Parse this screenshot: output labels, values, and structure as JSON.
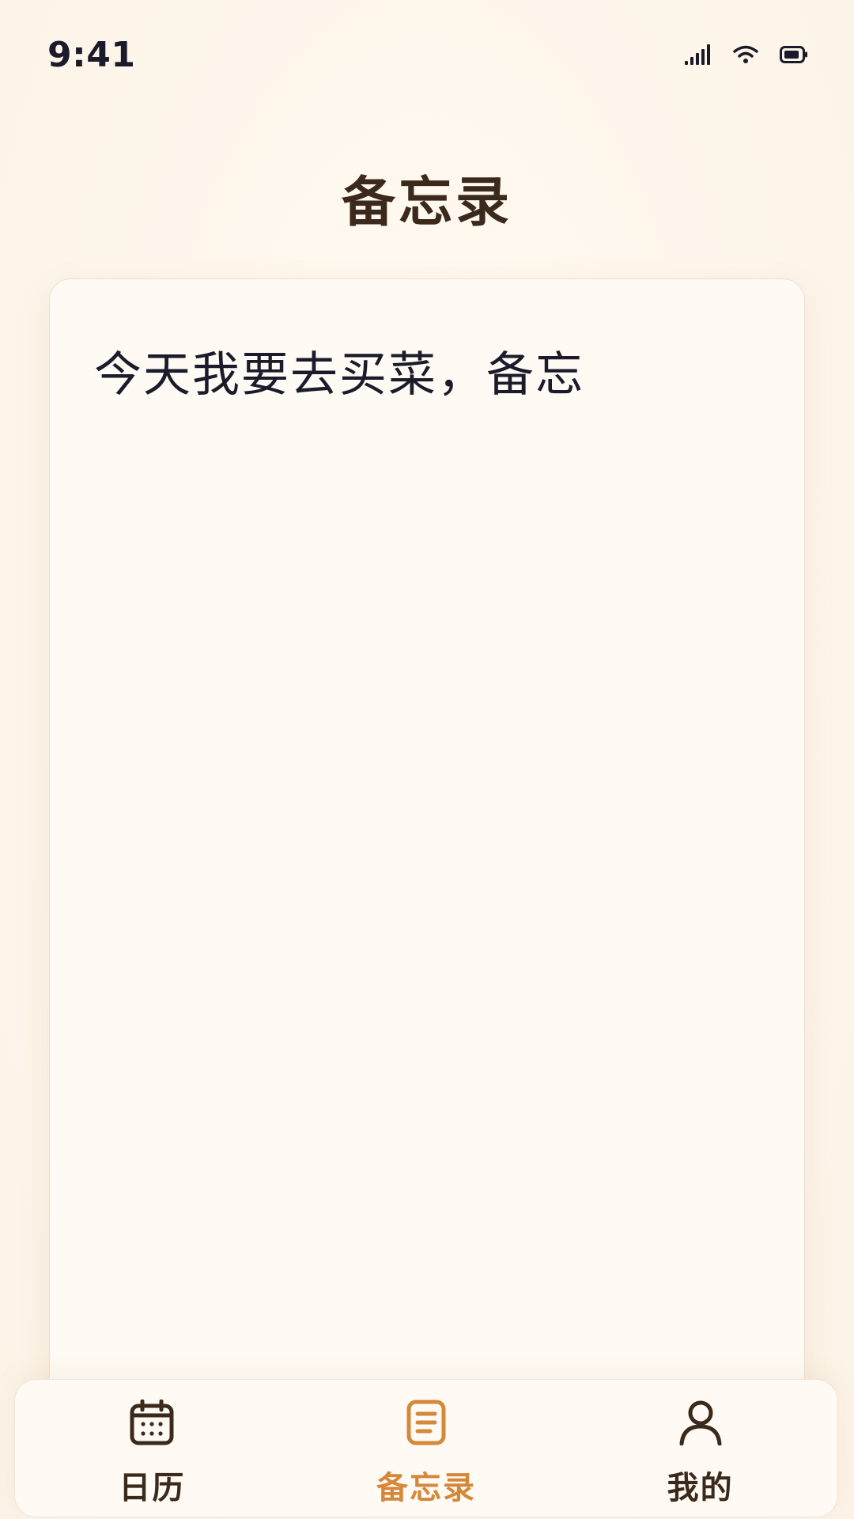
{
  "status_bar": {
    "time": "9:41",
    "icons": [
      "cellular-signal-icon",
      "wifi-icon",
      "battery-icon"
    ]
  },
  "header": {
    "title": "备忘录"
  },
  "memo": {
    "content": "今天我要去买菜，备忘"
  },
  "bottom_nav": {
    "items": [
      {
        "label": "日历",
        "icon": "calendar-icon",
        "active": false
      },
      {
        "label": "备忘录",
        "icon": "document-icon",
        "active": true
      },
      {
        "label": "我的",
        "icon": "person-icon",
        "active": false
      }
    ]
  },
  "colors": {
    "background": "#fdf7ee",
    "title": "#3b2a1c",
    "text": "#1b1b2b",
    "accent": "#d4883a"
  }
}
